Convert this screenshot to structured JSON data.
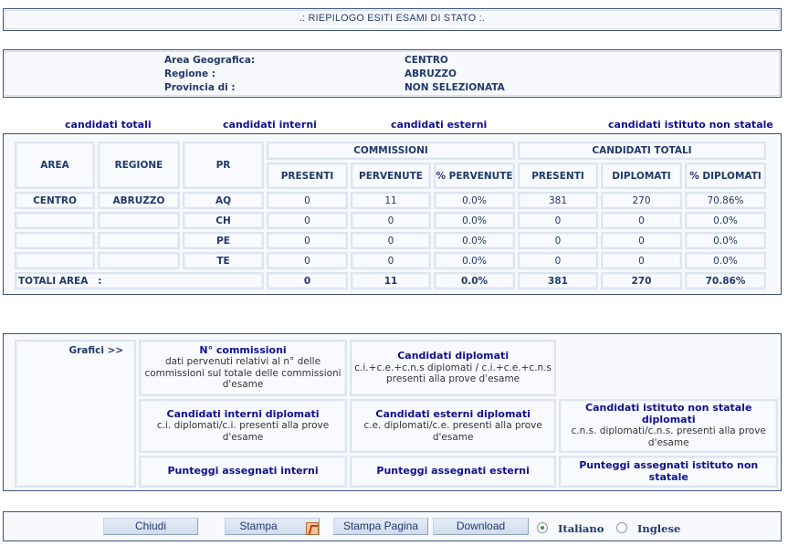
{
  "title": ".: RIEPILOGO ESITI ESAMI DI STATO :.",
  "info": {
    "rows": [
      {
        "label": "Area Geografica:",
        "value": "CENTRO"
      },
      {
        "label": "Regione :",
        "value": "ABRUZZO"
      },
      {
        "label": "Provincia di :",
        "value": "NON SELEZIONATA"
      }
    ]
  },
  "categories": [
    {
      "label": "candidati totali"
    },
    {
      "label": "candidati interni"
    },
    {
      "label": "candidati esterni"
    },
    {
      "label": "candidati istituto non statale"
    }
  ],
  "table": {
    "headers": {
      "area": "AREA",
      "regione": "REGIONE",
      "pr": "PR",
      "commissioni": "COMMISSIONI",
      "candidati_totali": "CANDIDATI TOTALI",
      "presenti": "PRESENTI",
      "pervenute": "PERVENUTE",
      "pct_pervenute": "% PERVENUTE",
      "presenti2": "PRESENTI",
      "diplomati": "DIPLOMATI",
      "pct_diplomati": "% DIPLOMATI"
    },
    "rows": [
      {
        "area": "CENTRO",
        "regione": "ABRUZZO",
        "pr": "AQ",
        "presenti": "0",
        "pervenute": "11",
        "pct_pervenute": "0.0%",
        "cand_presenti": "381",
        "diplomati": "270",
        "pct_diplomati": "70.86%"
      },
      {
        "area": "",
        "regione": "",
        "pr": "CH",
        "presenti": "0",
        "pervenute": "0",
        "pct_pervenute": "0.0%",
        "cand_presenti": "0",
        "diplomati": "0",
        "pct_diplomati": "0.0%"
      },
      {
        "area": "",
        "regione": "",
        "pr": "PE",
        "presenti": "0",
        "pervenute": "0",
        "pct_pervenute": "0.0%",
        "cand_presenti": "0",
        "diplomati": "0",
        "pct_diplomati": "0.0%"
      },
      {
        "area": "",
        "regione": "",
        "pr": "TE",
        "presenti": "0",
        "pervenute": "0",
        "pct_pervenute": "0.0%",
        "cand_presenti": "0",
        "diplomati": "0",
        "pct_diplomati": "0.0%"
      }
    ],
    "totals": {
      "label": "TOTALI AREA   :",
      "presenti": "0",
      "pervenute": "11",
      "pct_pervenute": "0.0%",
      "cand_presenti": "381",
      "diplomati": "270",
      "pct_diplomati": "70.86%"
    }
  },
  "grafici": {
    "label": "Grafici >>",
    "items": [
      {
        "title": "N° commissioni",
        "desc": "dati pervenuti relativi al n° delle commissioni sul totale delle commissioni d'esame"
      },
      {
        "title": "Candidati diplomati",
        "desc": "c.i.+c.e.+c.n.s diplomati / c.i.+c.e.+c.n.s presenti alla prove d'esame"
      },
      {
        "title": "Candidati interni diplomati",
        "desc": "c.i. diplomati/c.i. presenti alla prove d'esame"
      },
      {
        "title": "Candidati esterni diplomati",
        "desc": "c.e. diplomati/c.e. presenti alla prove d'esame"
      },
      {
        "title": "Candidati istituto non statale diplomati",
        "desc": "c.n.s. diplomati/c.n.s. presenti alla prove d'esame"
      },
      {
        "title": "Punteggi assegnati interni",
        "desc": ""
      },
      {
        "title": "Punteggi assegnati esterni",
        "desc": ""
      },
      {
        "title": "Punteggi assegnati istituto non statale",
        "desc": ""
      }
    ]
  },
  "toolbar": {
    "chiudi": "Chiudi",
    "stampa": "Stampa",
    "stampa_icon": "pdf-icon",
    "stampa_pagina": "Stampa Pagina",
    "download": "Download",
    "languages": [
      {
        "label": "Italiano",
        "checked": true
      },
      {
        "label": "Inglese",
        "checked": false
      }
    ]
  }
}
